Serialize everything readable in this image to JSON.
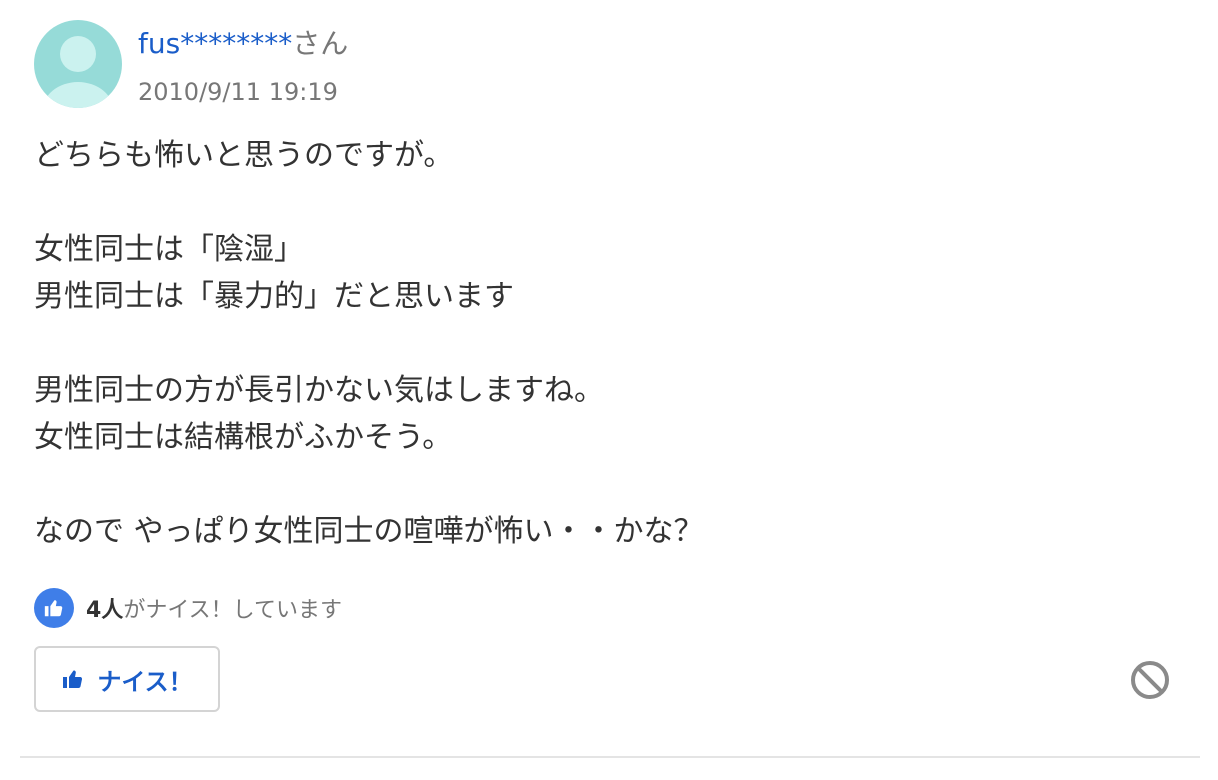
{
  "author": {
    "name": "fus********",
    "suffix": "さん"
  },
  "timestamp": "2010/9/11 19:19",
  "answer": {
    "lines": [
      "どちらも怖いと思うのですが。",
      "",
      "女性同士は「陰湿」",
      "男性同士は「暴力的」だと思います",
      "",
      "男性同士の方が長引かない気はしますね。",
      "女性同士は結構根がふかそう。",
      "",
      "なので やっぱり女性同士の喧嘩が怖い・・かな？"
    ]
  },
  "nice": {
    "count": "4人",
    "count_suffix": "がナイス！しています",
    "button_label": "ナイス！"
  },
  "colors": {
    "link": "#1a5dc9",
    "accent": "#3f7ee8",
    "muted": "#777777",
    "avatar": "#96dbd8"
  },
  "icons": {
    "avatar": "user-avatar-icon",
    "nice": "thumbs-up-icon",
    "block": "block-icon"
  }
}
